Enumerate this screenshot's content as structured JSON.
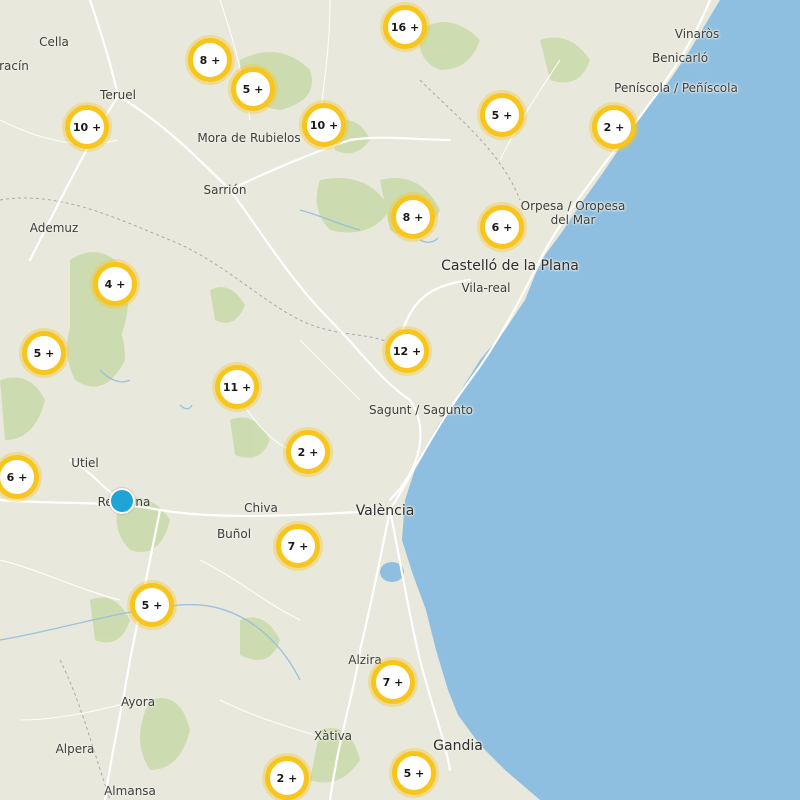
{
  "map": {
    "colors": {
      "land": "#e9e8dc",
      "sea": "#8fbfe0",
      "forest": "#c7d9a8",
      "cluster_ring": "#f7c51c",
      "marker": "#1fa4d6"
    },
    "places": [
      {
        "id": "cella",
        "name": "Cella"
      },
      {
        "id": "rracin",
        "name": "racín"
      },
      {
        "id": "teruel",
        "name": "Teruel"
      },
      {
        "id": "mora",
        "name": "Mora de Rubielos"
      },
      {
        "id": "sarrion",
        "name": "Sarrión"
      },
      {
        "id": "ademuz",
        "name": "Ademuz"
      },
      {
        "id": "vinaros",
        "name": "Vinaròs"
      },
      {
        "id": "benicarlo",
        "name": "Benicarló"
      },
      {
        "id": "peniscola",
        "name": "Peníscola / Peñíscola"
      },
      {
        "id": "oropesa",
        "name": "Orpesa / Oropesa\ndel Mar"
      },
      {
        "id": "castello",
        "name": "Castelló de la Plana",
        "big": true
      },
      {
        "id": "vilareal",
        "name": "Vila-real"
      },
      {
        "id": "sagunt",
        "name": "Sagunt / Sagunto"
      },
      {
        "id": "utiel",
        "name": "Utiel"
      },
      {
        "id": "requena",
        "name": "Requena"
      },
      {
        "id": "chiva",
        "name": "Chiva"
      },
      {
        "id": "bunol",
        "name": "Buñol"
      },
      {
        "id": "valencia",
        "name": "València",
        "big": true
      },
      {
        "id": "alzira",
        "name": "Alzira"
      },
      {
        "id": "ayora",
        "name": "Ayora"
      },
      {
        "id": "xativa",
        "name": "Xàtiva"
      },
      {
        "id": "gandia",
        "name": "Gandia",
        "big": true
      },
      {
        "id": "alpera",
        "name": "Alpera"
      },
      {
        "id": "almansa",
        "name": "Almansa"
      }
    ],
    "clusters": [
      {
        "id": "c1",
        "label": "16 +"
      },
      {
        "id": "c2",
        "label": "8 +"
      },
      {
        "id": "c3",
        "label": "5 +"
      },
      {
        "id": "c4",
        "label": "10 +"
      },
      {
        "id": "c5",
        "label": "10 +"
      },
      {
        "id": "c6",
        "label": "5 +"
      },
      {
        "id": "c7",
        "label": "2 +"
      },
      {
        "id": "c8",
        "label": "8 +"
      },
      {
        "id": "c9",
        "label": "6 +"
      },
      {
        "id": "c10",
        "label": "4 +"
      },
      {
        "id": "c11",
        "label": "5 +"
      },
      {
        "id": "c12",
        "label": "12 +"
      },
      {
        "id": "c13",
        "label": "11 +"
      },
      {
        "id": "c14",
        "label": "2 +"
      },
      {
        "id": "c15",
        "label": "6 +"
      },
      {
        "id": "c16",
        "label": "7 +"
      },
      {
        "id": "c17",
        "label": "5 +"
      },
      {
        "id": "c18",
        "label": "7 +"
      },
      {
        "id": "c19",
        "label": "2 +"
      },
      {
        "id": "c20",
        "label": "5 +"
      }
    ],
    "selected_marker": {
      "name": "selected-location"
    }
  }
}
